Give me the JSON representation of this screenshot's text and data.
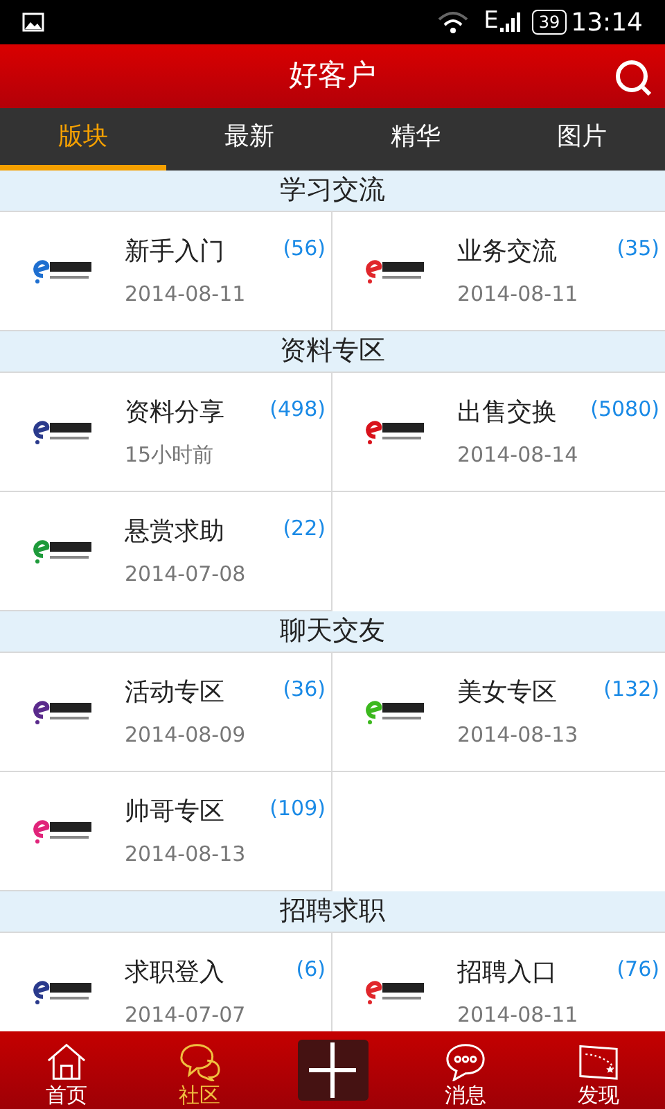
{
  "status_bar": {
    "network": "E",
    "battery": "39",
    "time": "13:14"
  },
  "header": {
    "title": "好客户"
  },
  "tabs": [
    {
      "label": "版块",
      "selected": true
    },
    {
      "label": "最新",
      "selected": false
    },
    {
      "label": "精华",
      "selected": false
    },
    {
      "label": "图片",
      "selected": false
    }
  ],
  "sections": [
    {
      "title": "学习交流",
      "forums": [
        {
          "name": "新手入门",
          "count": "(56)",
          "date": "2014-08-11",
          "color": "#1e6fd0"
        },
        {
          "name": "业务交流",
          "count": "(35)",
          "date": "2014-08-11",
          "color": "#e0262b"
        }
      ]
    },
    {
      "title": "资料专区",
      "forums": [
        {
          "name": "资料分享",
          "count": "(498)",
          "date": "15小时前",
          "color": "#2a3a8c"
        },
        {
          "name": "出售交换",
          "count": "(5080)",
          "date": "2014-08-14",
          "color": "#d8121b"
        },
        {
          "name": "悬赏求助",
          "count": "(22)",
          "date": "2014-07-08",
          "color": "#1d9a3a"
        }
      ]
    },
    {
      "title": "聊天交友",
      "forums": [
        {
          "name": "活动专区",
          "count": "(36)",
          "date": "2014-08-09",
          "color": "#5a2a8c"
        },
        {
          "name": "美女专区",
          "count": "(132)",
          "date": "2014-08-13",
          "color": "#3cb81e"
        },
        {
          "name": "帅哥专区",
          "count": "(109)",
          "date": "2014-08-13",
          "color": "#e0237a"
        }
      ]
    },
    {
      "title": "招聘求职",
      "forums": [
        {
          "name": "求职登入",
          "count": "(6)",
          "date": "2014-07-07",
          "color": "#2a3a8c"
        },
        {
          "name": "招聘入口",
          "count": "(76)",
          "date": "2014-08-11",
          "color": "#e0262b"
        }
      ]
    }
  ],
  "bottom_nav": [
    {
      "kind": "home",
      "label": "首页",
      "selected": false
    },
    {
      "kind": "chat",
      "label": "社区",
      "selected": true
    },
    {
      "kind": "plus",
      "selected": false
    },
    {
      "kind": "message",
      "label": "消息",
      "selected": false
    },
    {
      "kind": "flag",
      "label": "发现",
      "selected": false
    }
  ]
}
